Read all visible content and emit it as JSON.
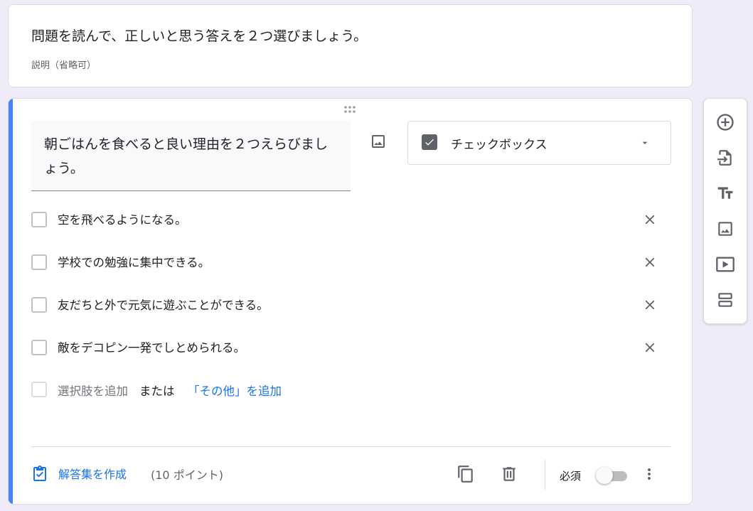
{
  "header": {
    "title": "問題を読んで、正しいと思う答えを２つ選びましょう。",
    "description_placeholder": "説明（省略可）"
  },
  "question": {
    "text": "朝ごはんを食べると良い理由を２つえらびましょう。",
    "type_label": "チェックボックス",
    "options": [
      {
        "label": "空を飛べるようになる。"
      },
      {
        "label": "学校での勉強に集中できる。"
      },
      {
        "label": "友だちと外で元気に遊ぶことができる。"
      },
      {
        "label": "敵をデコピン一発でしとめられる。"
      }
    ],
    "add_option_label": "選択肢を追加",
    "or_label": "または",
    "add_other_label": "「その他」を追加"
  },
  "footer": {
    "answer_key_label": "解答集を作成",
    "points_label": "(10 ポイント)",
    "required_label": "必須",
    "required_on": false
  },
  "toolbar": {
    "items": [
      "add-question-icon",
      "import-questions-icon",
      "add-title-icon",
      "add-image-icon",
      "add-video-icon",
      "add-section-icon"
    ]
  },
  "colors": {
    "accent": "#4285f4",
    "link": "#1a73e8",
    "background": "#efebf9"
  }
}
